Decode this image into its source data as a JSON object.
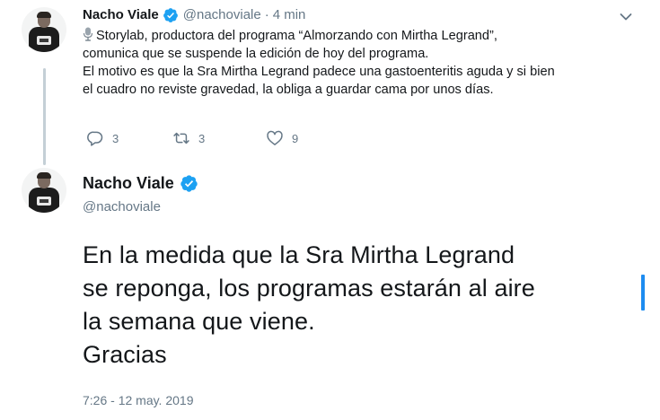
{
  "tweet1": {
    "author_name": "Nacho Viale",
    "author_handle": "@nachoviale",
    "separator": "·",
    "time_ago": "4 min",
    "lines": [
      "Storylab, productora del programa “Almorzando con Mirtha Legrand”,",
      "comunica que se suspende la edición de hoy del programa.",
      "El motivo es que la Sra Mirtha Legrand padece una gastoenteritis aguda y si bien",
      "el cuadro no reviste gravedad,  la obliga a guardar cama por unos días."
    ],
    "reply_count": "3",
    "retweet_count": "3",
    "like_count": "9"
  },
  "tweet2": {
    "author_name": "Nacho Viale",
    "author_handle": "@nachoviale",
    "lines": [
      "En la medida que la Sra Mirtha Legrand",
      "se reponga, los programas estarán al aire",
      "la semana que viene.",
      "Gracias"
    ],
    "timestamp": "7:26 - 12 may. 2019"
  },
  "icons": {
    "verified": "verified-badge-icon",
    "microphone": "microphone-icon",
    "reply": "reply-icon",
    "retweet": "retweet-icon",
    "like": "heart-icon",
    "caret": "chevron-down-icon"
  },
  "colors": {
    "accent": "#1da1f2",
    "text": "#14171a",
    "secondary": "#657786",
    "thread_line": "#c4cfd6"
  }
}
